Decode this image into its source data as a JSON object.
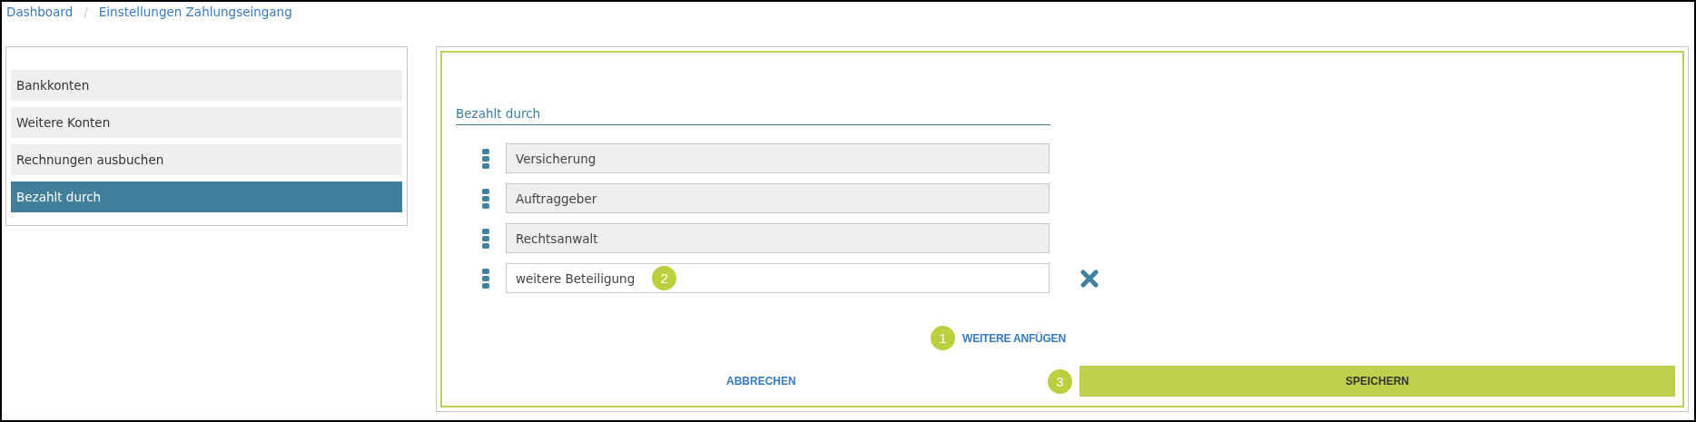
{
  "breadcrumb": [
    "Dashboard",
    "Einstellungen Zahlungseingang"
  ],
  "breadcrumb_separator": "/",
  "sidebar": {
    "items": [
      {
        "label": "Bankkonten",
        "selected": false
      },
      {
        "label": "Weitere Konten",
        "selected": false
      },
      {
        "label": "Rechnungen ausbuchen",
        "selected": false
      },
      {
        "label": "Bezahlt durch",
        "selected": true
      }
    ]
  },
  "section": {
    "title": "Bezahlt durch",
    "rows": [
      {
        "value": "Versicherung",
        "disabled": true,
        "removable": false
      },
      {
        "value": "Auftraggeber",
        "disabled": true,
        "removable": false
      },
      {
        "value": "Rechtsanwalt",
        "disabled": true,
        "removable": false
      },
      {
        "value": "weitere Beteiligung",
        "disabled": false,
        "removable": true,
        "badge": "2"
      }
    ],
    "add_link": {
      "label": "WEITERE ANFÜGEN",
      "badge": "1"
    },
    "cancel": {
      "label": "ABBRECHEN"
    },
    "save": {
      "label": "SPEICHERN",
      "badge": "3"
    }
  }
}
